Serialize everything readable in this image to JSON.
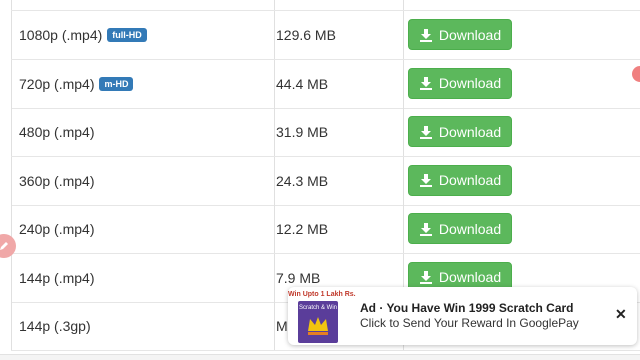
{
  "rows": [
    {
      "format": "1080p (.mp4)",
      "badge": "full-HD",
      "size": "129.6 MB",
      "button": "Download"
    },
    {
      "format": "720p (.mp4)",
      "badge": "m-HD",
      "size": "44.4 MB",
      "button": "Download"
    },
    {
      "format": "480p (.mp4)",
      "badge": "",
      "size": "31.9 MB",
      "button": "Download"
    },
    {
      "format": "360p (.mp4)",
      "badge": "",
      "size": "24.3 MB",
      "button": "Download"
    },
    {
      "format": "240p (.mp4)",
      "badge": "",
      "size": "12.2 MB",
      "button": "Download"
    },
    {
      "format": "144p (.mp4)",
      "badge": "",
      "size": "7.9 MB",
      "button": "Download"
    },
    {
      "format": "144p (.3gp)",
      "badge": "",
      "size": "M",
      "button": ""
    }
  ],
  "ad": {
    "thumb_caption": "Win Upto 1 Lakh Rs.",
    "thumb_title": "Scratch & Win",
    "title": "Ad · You Have Win 1999 Scratch Card",
    "subtitle": "Click to Send Your Reward In GooglePay",
    "close": "✕"
  },
  "colors": {
    "download_button": "#5cb85c",
    "badge": "#337ab7",
    "edge_dot": "#f08080"
  },
  "icons": {
    "download": "download-icon",
    "pencil": "pencil-icon",
    "close": "close-icon"
  }
}
